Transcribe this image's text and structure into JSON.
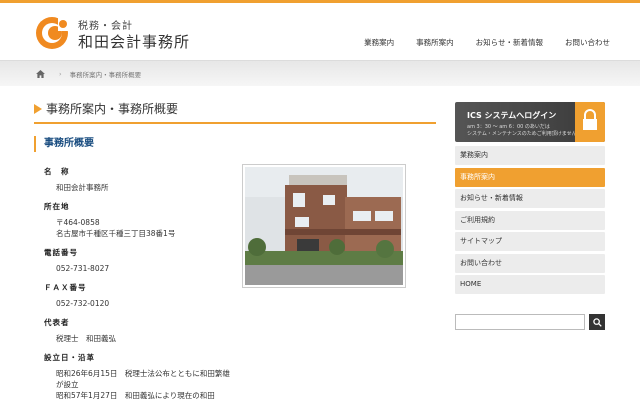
{
  "header": {
    "logo_sub": "税務・会計",
    "logo_main": "和田会計事務所",
    "nav": [
      "業務案内",
      "事務所案内",
      "お知らせ・新着情報",
      "お問い合わせ"
    ]
  },
  "breadcrumb": {
    "current": "事務所案内・事務所概要"
  },
  "main": {
    "title": "事務所案内・事務所概要",
    "section_title": "事務所概要",
    "info": [
      {
        "label": "名　称",
        "value": "和田会計事務所"
      },
      {
        "label": "所在地",
        "value": "〒464-0858\n名古屋市千種区千種三丁目38番1号"
      },
      {
        "label": "電話番号",
        "value": "052-731-8027"
      },
      {
        "label": "ＦＡＸ番号",
        "value": "052-732-0120"
      },
      {
        "label": "代表者",
        "value": "税理士　和田義弘"
      },
      {
        "label": "設立日・沿革",
        "value": "昭和26年6月15日　税理士法公布とともに和田繁雄が設立\n昭和57年1月27日　和田義弘により現在の和田"
      }
    ]
  },
  "sidebar": {
    "ics_title": "ICS システムへログイン",
    "ics_note_1": "am 3：30 ～ am 6：00 のあいだは",
    "ics_note_2": "システム・メンテナンスのためご利用頂けません。",
    "menu": [
      "業務案内",
      "事務所案内",
      "お知らせ・新着情報",
      "ご利用規約",
      "サイトマップ",
      "お問い合わせ",
      "HOME"
    ],
    "active_index": 1
  },
  "colors": {
    "accent": "#f0a030",
    "heading_blue": "#1a4d80"
  }
}
